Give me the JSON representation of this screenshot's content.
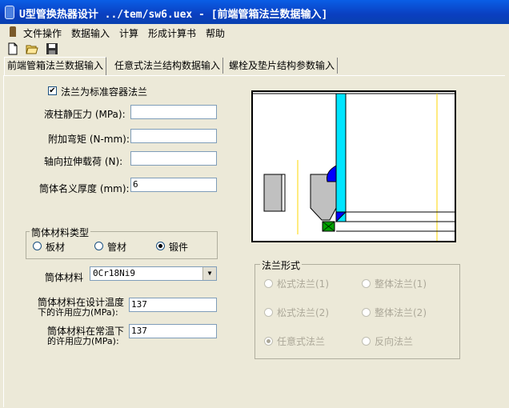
{
  "window": {
    "title": "U型管换热器设计 ../tem/sw6.uex - [前端管箱法兰数据输入]"
  },
  "menu": [
    "文件操作",
    "数据输入",
    "计算",
    "形成计算书",
    "帮助"
  ],
  "tabs": [
    "前端管箱法兰数据输入",
    "任意式法兰结构数据输入",
    "螺栓及垫片结构参数输入"
  ],
  "form": {
    "std_flange_label": "法兰为标准容器法兰",
    "std_flange_checked": true,
    "pressure_label": "液柱静压力 (MPa):",
    "pressure_value": "",
    "moment_label": "附加弯矩 (N-mm):",
    "moment_value": "",
    "axial_label": "轴向拉伸载荷 (N):",
    "axial_value": "",
    "thickness_label": "筒体名义厚度 (mm):",
    "thickness_value": "6"
  },
  "material_type": {
    "legend": "筒体材料类型",
    "options": [
      "板材",
      "管材",
      "锻件"
    ],
    "selected": "锻件"
  },
  "material": {
    "label": "筒体材料",
    "value": "0Cr18Ni9",
    "design_stress_label_1": "筒体材料在设计温度",
    "design_stress_label_2": "下的许用应力(MPa):",
    "design_stress_value": "137",
    "room_stress_label_1": "筒体材料在常温下",
    "room_stress_label_2": "的许用应力(MPa):",
    "room_stress_value": "137"
  },
  "flange_form": {
    "legend": "法兰形式",
    "options": [
      "松式法兰(1)",
      "整体法兰(1)",
      "松式法兰(2)",
      "整体法兰(2)",
      "任意式法兰",
      "反向法兰"
    ],
    "selected": "任意式法兰"
  },
  "colors": {
    "title_bar": "#0a4ad6",
    "pipe": "#00e5ff",
    "hub": "#0000ff",
    "gasket": "#00a000",
    "flange": "#c0c0c0",
    "center_line": "#ffd700"
  }
}
